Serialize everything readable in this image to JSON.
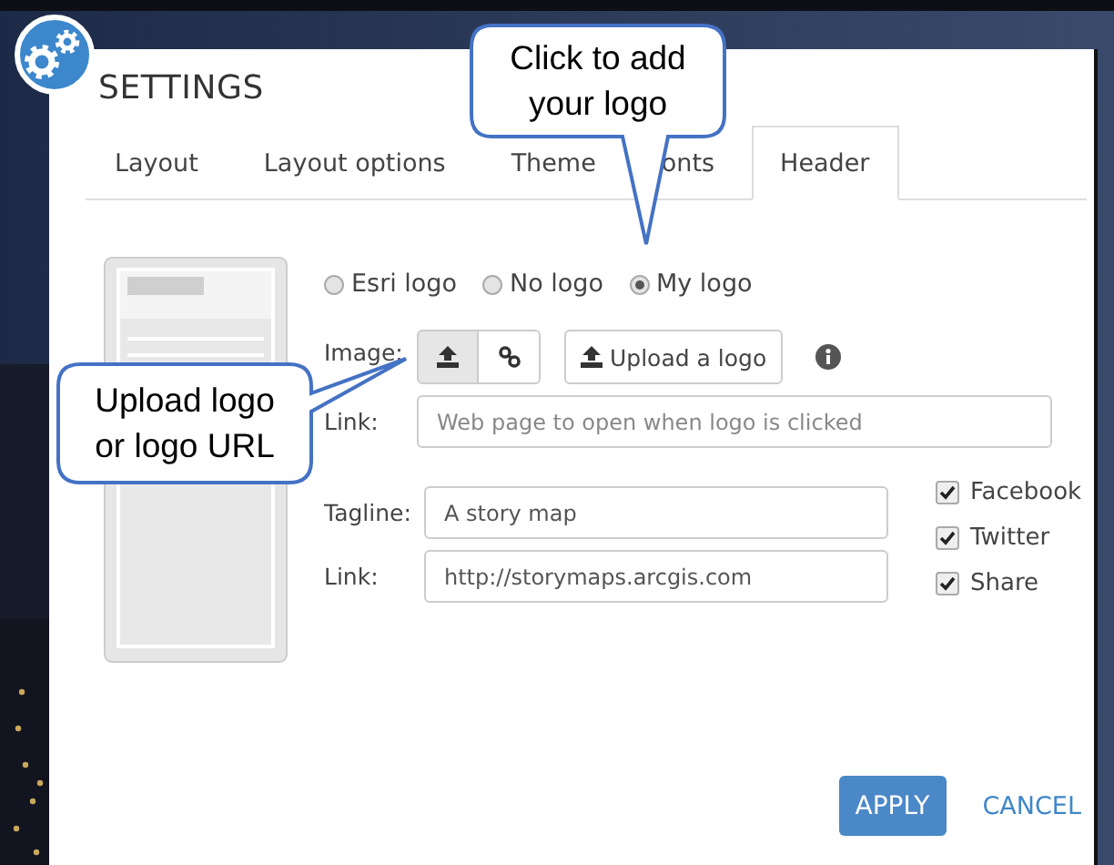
{
  "dialog": {
    "title": "SETTINGS",
    "tabs": [
      {
        "label": "Layout",
        "selected": false
      },
      {
        "label": "Layout options",
        "selected": false
      },
      {
        "label": "Theme",
        "selected": false
      },
      {
        "label": "onts",
        "selected": false
      },
      {
        "label": "Header",
        "selected": true
      }
    ],
    "logo_options": [
      {
        "label": "Esri logo",
        "selected": false
      },
      {
        "label": "No logo",
        "selected": false
      },
      {
        "label": "My logo",
        "selected": true
      }
    ],
    "image": {
      "label": "Image:",
      "modes": [
        {
          "kind": "upload",
          "selected": true
        },
        {
          "kind": "link",
          "selected": false
        }
      ],
      "upload_button": "Upload a logo"
    },
    "logo_link": {
      "label": "Link:",
      "placeholder": "Web page to open when logo is clicked"
    },
    "tagline": {
      "label": "Tagline:",
      "value": "A story map"
    },
    "tagline_link": {
      "label": "Link:",
      "value": "http://storymaps.arcgis.com"
    },
    "social": [
      {
        "label": "Facebook",
        "checked": true
      },
      {
        "label": "Twitter",
        "checked": true
      },
      {
        "label": "Share",
        "checked": true
      }
    ],
    "buttons": {
      "apply": "APPLY",
      "cancel": "CANCEL"
    }
  },
  "callouts": [
    {
      "text": "Click to add your logo",
      "kind": "down"
    },
    {
      "text": "Upload logo or logo URL",
      "kind": "right"
    }
  ]
}
